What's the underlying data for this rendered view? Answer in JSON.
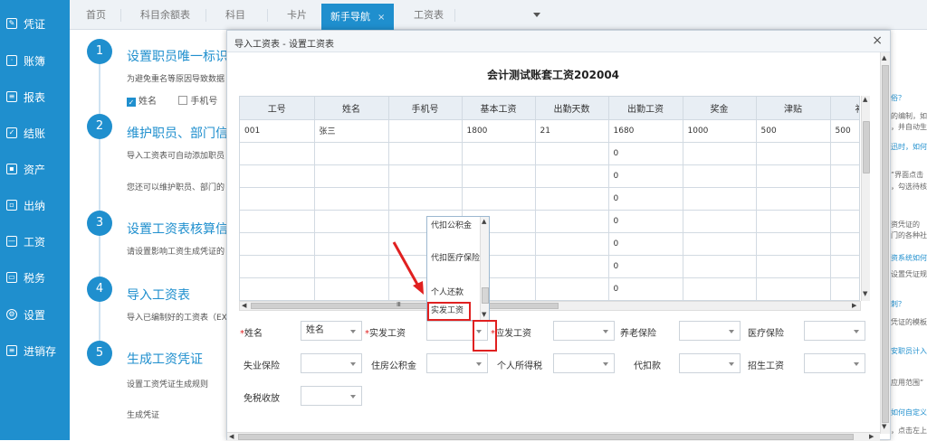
{
  "sidebar": {
    "items": [
      {
        "label": "凭证",
        "icon": "voucher-icon"
      },
      {
        "label": "账簿",
        "icon": "ledger-icon"
      },
      {
        "label": "报表",
        "icon": "report-icon"
      },
      {
        "label": "结账",
        "icon": "close-account-icon"
      },
      {
        "label": "资产",
        "icon": "asset-icon"
      },
      {
        "label": "出纳",
        "icon": "cashier-icon"
      },
      {
        "label": "工资",
        "icon": "salary-icon"
      },
      {
        "label": "税务",
        "icon": "tax-icon"
      },
      {
        "label": "设置",
        "icon": "gear-icon"
      },
      {
        "label": "进销存",
        "icon": "inventory-icon"
      }
    ]
  },
  "tabs": [
    {
      "label": "首页"
    },
    {
      "label": "科目余额表"
    },
    {
      "label": "科目"
    },
    {
      "label": "卡片"
    },
    {
      "label": "新手导航",
      "active": true,
      "close": "×"
    },
    {
      "label": "工资表"
    }
  ],
  "guide": {
    "steps": [
      {
        "num": "1",
        "title": "设置职员唯一标识",
        "desc": "为避免重名等原因导致数据"
      },
      {
        "num": "2",
        "title": "维护职员、部门信",
        "desc": "导入工资表可自动添加职员",
        "desc2": "您还可以维护职员、部门的"
      },
      {
        "num": "3",
        "title": "设置工资表核算信",
        "desc": "请设置影响工资生成凭证的"
      },
      {
        "num": "4",
        "title": "导入工资表",
        "desc": "导入已编制好的工资表（EX"
      },
      {
        "num": "5",
        "title": "生成工资凭证",
        "desc": "设置工资凭证生成规则",
        "desc2": "生成凭证"
      }
    ],
    "checkbox_name": "姓名",
    "checkbox_phone": "手机号"
  },
  "right_panel": {
    "lines": [
      "俗？",
      "的编制，如",
      "，并自动生",
      "迅时，如何",
      "”界面点击",
      "，勾选待核",
      "资凭证的",
      "门的各种社",
      "资系统如何",
      "设置凭证规",
      "刺？",
      "凭证的模板",
      "安职员计入",
      "应用范围”",
      "如何自定义",
      "，点击左上"
    ]
  },
  "modal": {
    "title": "导入工资表 - 设置工资表",
    "close": "×",
    "sheet_title": "会计测试账套工资202004",
    "columns": [
      "工号",
      "姓名",
      "手机号",
      "基本工资",
      "出勤天数",
      "出勤工资",
      "奖金",
      "津贴",
      "补贴"
    ],
    "rows": [
      [
        "001",
        "张三",
        "",
        "1800",
        "21",
        "1680",
        "1000",
        "500",
        "500"
      ],
      [
        "",
        "",
        "",
        "",
        "",
        "0",
        "",
        "",
        ""
      ],
      [
        "",
        "",
        "",
        "",
        "",
        "0",
        "",
        "",
        ""
      ],
      [
        "",
        "",
        "",
        "",
        "",
        "0",
        "",
        "",
        ""
      ],
      [
        "",
        "",
        "",
        "",
        "",
        "0",
        "",
        "",
        ""
      ],
      [
        "",
        "",
        "",
        "",
        "",
        "0",
        "",
        "",
        ""
      ],
      [
        "",
        "",
        "",
        "",
        "",
        "0",
        "",
        "",
        ""
      ],
      [
        "",
        "",
        "",
        "",
        "",
        "0",
        "",
        "",
        ""
      ]
    ],
    "mapping": [
      {
        "label": "姓名",
        "required": true,
        "value": "姓名"
      },
      {
        "label": "实发工资",
        "required": true,
        "value": ""
      },
      {
        "label": "应发工资",
        "required": true,
        "value": ""
      },
      {
        "label": "养老保险",
        "required": false,
        "value": ""
      },
      {
        "label": "医疗保险",
        "required": false,
        "value": ""
      },
      {
        "label": "失业保险",
        "required": false,
        "value": ""
      },
      {
        "label": "住房公积金",
        "required": false,
        "value": ""
      },
      {
        "label": "个人所得税",
        "required": false,
        "value": ""
      },
      {
        "label": "代扣款",
        "required": false,
        "value": ""
      },
      {
        "label": "招生工资",
        "required": false,
        "value": ""
      },
      {
        "label": "免税收放",
        "required": false,
        "value": ""
      }
    ],
    "dropdown_options": [
      "代扣公积金",
      "代扣医疗保险",
      "个人还款",
      "实发工资"
    ],
    "required_mark": "*",
    "scroll_mark": "Ⅲ"
  }
}
